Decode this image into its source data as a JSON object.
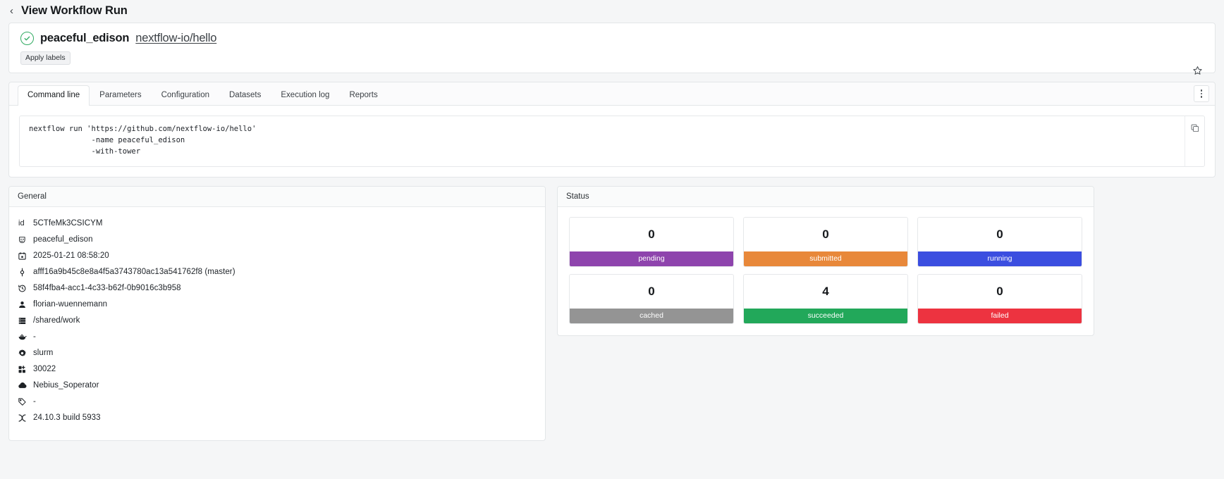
{
  "topbar": {
    "back_icon": "chevron-left-icon",
    "title": "View Workflow Run"
  },
  "header": {
    "status_icon": "check-circle-icon",
    "run_name": "peaceful_edison",
    "repo_link": "nextflow-io/hello",
    "apply_labels": "Apply labels",
    "star_icon": "star-outline-icon"
  },
  "tabs": {
    "items": [
      {
        "label": "Command line",
        "active": true
      },
      {
        "label": "Parameters",
        "active": false
      },
      {
        "label": "Configuration",
        "active": false
      },
      {
        "label": "Datasets",
        "active": false
      },
      {
        "label": "Execution log",
        "active": false
      },
      {
        "label": "Reports",
        "active": false
      }
    ],
    "kebab_icon": "more-vertical-icon"
  },
  "command_line": {
    "text": "nextflow run 'https://github.com/nextflow-io/hello'\n              -name peaceful_edison\n              -with-tower",
    "copy_icon": "copy-icon"
  },
  "general": {
    "title": "General",
    "rows": [
      {
        "icon": "id-label",
        "value": "5CTfeMk3CSICYM"
      },
      {
        "icon": "theater-masks-icon",
        "value": "peaceful_edison"
      },
      {
        "icon": "calendar-icon",
        "value": "2025-01-21 08:58:20"
      },
      {
        "icon": "git-commit-icon",
        "value": "afff16a9b45c8e8a4f5a3743780ac13a541762f8 (master)"
      },
      {
        "icon": "history-clock-icon",
        "value": "58f4fba4-acc1-4c33-b62f-0b9016c3b958"
      },
      {
        "icon": "user-icon",
        "value": "florian-wuennemann"
      },
      {
        "icon": "server-stack-icon",
        "value": "/shared/work"
      },
      {
        "icon": "docker-whale-icon",
        "value": "-"
      },
      {
        "icon": "gear-icon",
        "value": "slurm"
      },
      {
        "icon": "puzzle-icon",
        "value": "30022"
      },
      {
        "icon": "cloud-icon",
        "value": "Nebius_Soperator"
      },
      {
        "icon": "tag-icon",
        "value": "-"
      },
      {
        "icon": "nextflow-icon",
        "value": "24.10.3 build 5933"
      }
    ]
  },
  "status": {
    "title": "Status",
    "cards": [
      {
        "count": "0",
        "label": "pending",
        "color": "#8e44ad"
      },
      {
        "count": "0",
        "label": "submitted",
        "color": "#e8883a"
      },
      {
        "count": "0",
        "label": "running",
        "color": "#3b4ee0"
      },
      {
        "count": "0",
        "label": "cached",
        "color": "#949494"
      },
      {
        "count": "4",
        "label": "succeeded",
        "color": "#22a85a"
      },
      {
        "count": "0",
        "label": "failed",
        "color": "#ed3340"
      }
    ]
  }
}
